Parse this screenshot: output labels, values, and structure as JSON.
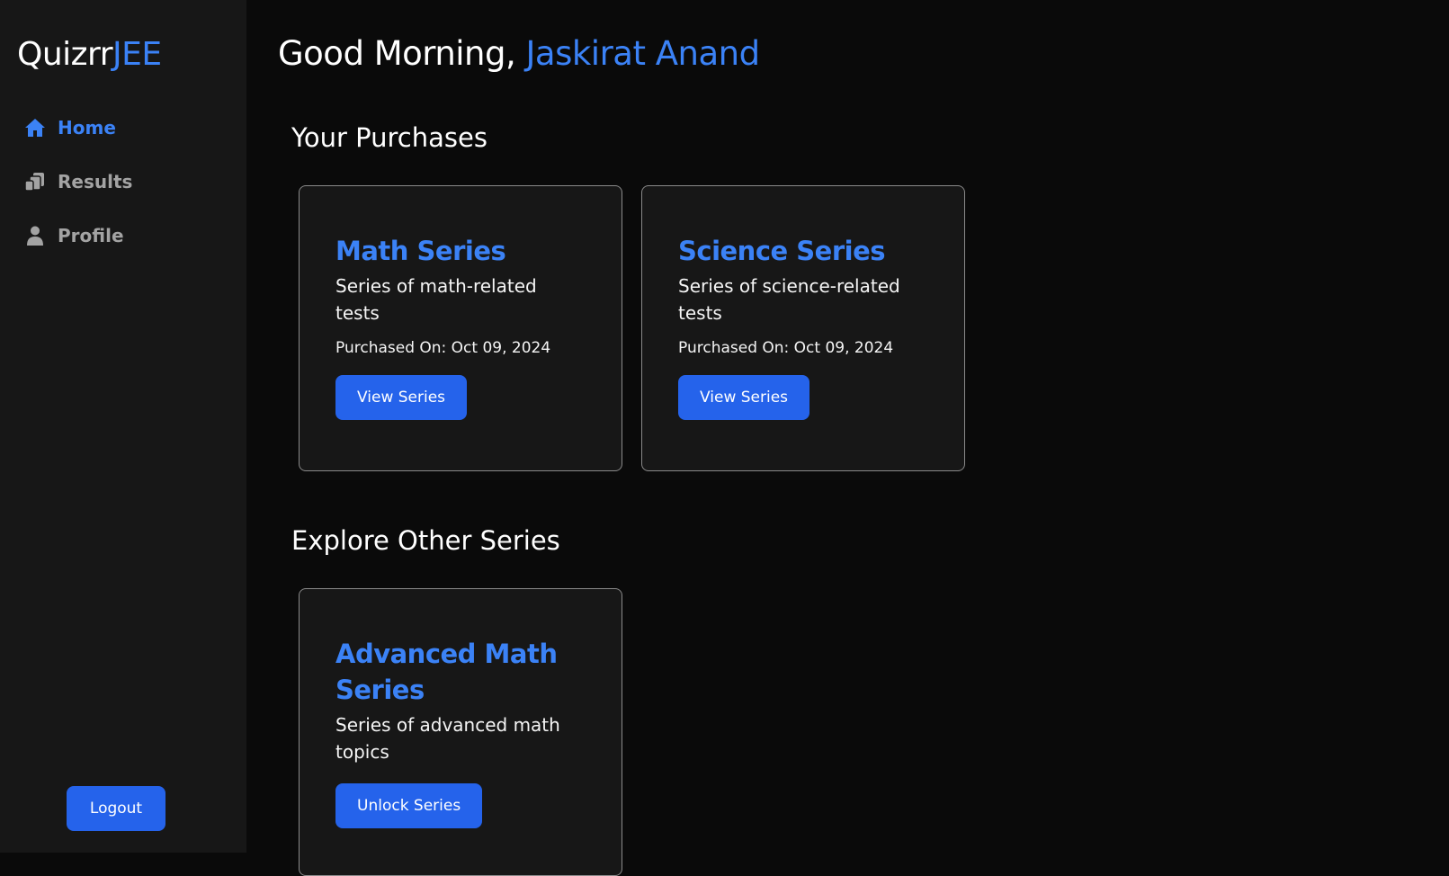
{
  "sidebar": {
    "logo_main": "Quizrr",
    "logo_accent": "JEE",
    "nav": [
      {
        "label": "Home",
        "icon": "home-icon",
        "active": true
      },
      {
        "label": "Results",
        "icon": "results-icon",
        "active": false
      },
      {
        "label": "Profile",
        "icon": "user-icon",
        "active": false
      }
    ],
    "logout_label": "Logout"
  },
  "header": {
    "greeting_prefix": "Good Morning,",
    "user_name": "Jaskirat Anand"
  },
  "purchases": {
    "title": "Your Purchases",
    "cards": [
      {
        "title": "Math Series",
        "description": "Series of math-related tests",
        "purchased_on": "Purchased On: Oct 09, 2024",
        "button_label": "View Series"
      },
      {
        "title": "Science Series",
        "description": "Series of science-related tests",
        "purchased_on": "Purchased On: Oct 09, 2024",
        "button_label": "View Series"
      }
    ]
  },
  "explore": {
    "title": "Explore Other Series",
    "cards": [
      {
        "title": "Advanced Math Series",
        "description": "Series of advanced math topics",
        "button_label": "Unlock Series"
      }
    ]
  },
  "colors": {
    "accent": "#3b82f6",
    "button": "#2563eb",
    "background": "#0a0a0a",
    "sidebar": "#171717"
  }
}
